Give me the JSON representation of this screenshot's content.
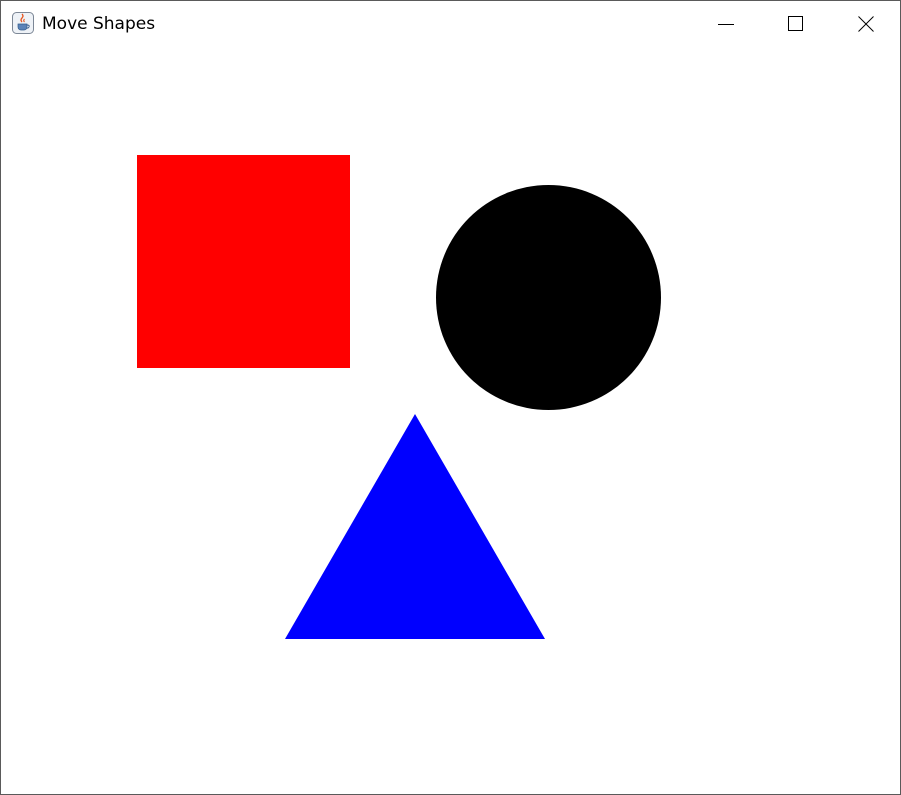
{
  "window": {
    "title": "Move Shapes",
    "app_icon": "java-coffee-cup-icon",
    "controls": {
      "minimize_icon": "minimize-icon",
      "maximize_icon": "maximize-icon",
      "close_icon": "close-icon"
    }
  },
  "canvas": {
    "background": "#ffffff",
    "shapes": [
      {
        "kind": "square",
        "color": "#ff0000"
      },
      {
        "kind": "circle",
        "color": "#000000"
      },
      {
        "kind": "triangle",
        "color": "#0000ff"
      }
    ]
  }
}
